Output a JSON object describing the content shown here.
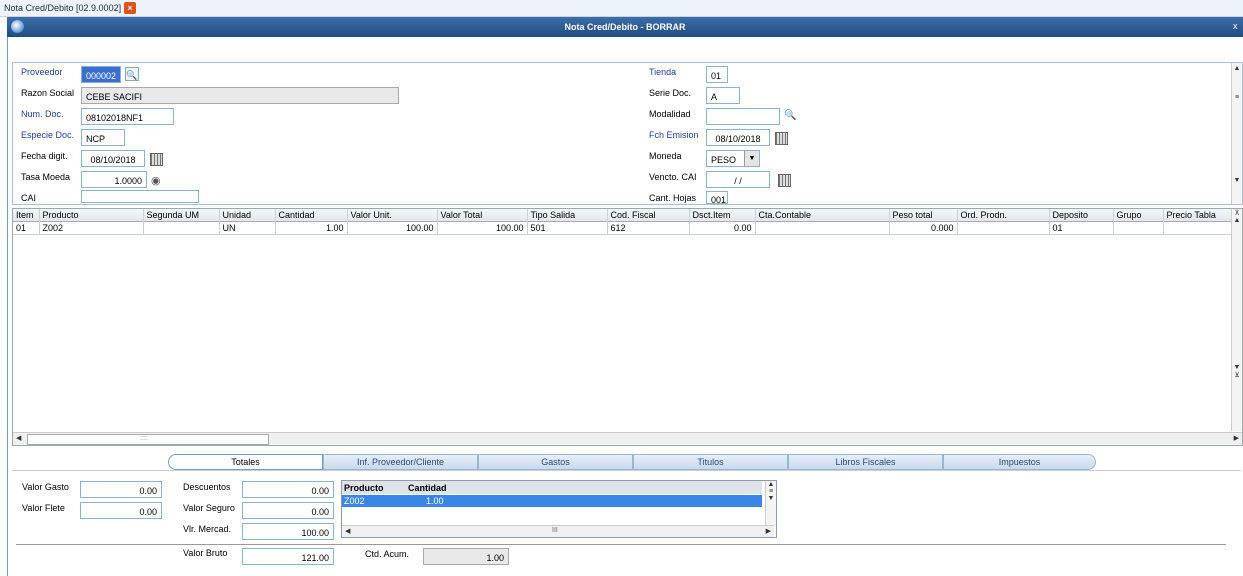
{
  "tab": {
    "label": "Nota Cred/Debito [02.9.0002]",
    "close": "×"
  },
  "window": {
    "title": "Nota Cred/Debito - BORRAR",
    "close": "x"
  },
  "header": {
    "proveedor": {
      "label": "Proveedor",
      "value": "000002"
    },
    "razon_social": {
      "label": "Razon Social",
      "value": "CEBE SACIFI"
    },
    "num_doc": {
      "label": "Num. Doc.",
      "value": "08102018NF1"
    },
    "especie_doc": {
      "label": "Especie Doc.",
      "value": "NCP"
    },
    "fecha_digit": {
      "label": "Fecha digit.",
      "value": "08/10/2018"
    },
    "tasa_moeda": {
      "label": "Tasa Moeda",
      "value": "1.0000"
    },
    "cai": {
      "label": "CAI",
      "value": ""
    },
    "tienda": {
      "label": "Tienda",
      "value": "01"
    },
    "serie_doc": {
      "label": "Serie Doc.",
      "value": "A"
    },
    "modalidad": {
      "label": "Modalidad",
      "value": ""
    },
    "fch_emision": {
      "label": "Fch Emision",
      "value": "08/10/2018"
    },
    "moneda": {
      "label": "Moneda",
      "value": "PESO"
    },
    "vencto_cai": {
      "label": "Vencto. CAI",
      "value": "/ /"
    },
    "cant_hojas": {
      "label": "Cant. Hojas",
      "value": "001"
    }
  },
  "grid": {
    "columns": [
      "Item",
      "Producto",
      "Segunda UM",
      "Unidad",
      "Cantidad",
      "Valor Unit.",
      "Valor Total",
      "Tipo Salida",
      "Cod. Fiscal",
      "Dsct.Item",
      "Cta.Contable",
      "Peso total",
      "Ord. Prodn.",
      "Deposito",
      "Grupo",
      "Precio Tabla"
    ],
    "rows": [
      [
        "01",
        "Z002",
        "",
        "UN",
        "1.00",
        "100.00",
        "100.00",
        "501",
        "612",
        "0.00",
        "",
        "0.000",
        "",
        "01",
        "",
        ""
      ]
    ],
    "hscroll_mark": "::::"
  },
  "bottom_tabs": [
    "Totales",
    "Inf. Proveedor/Cliente",
    "Gastos",
    "Titulos",
    "Libros Fiscales",
    "Impuestos"
  ],
  "totals": {
    "valor_gasto": {
      "label": "Valor Gasto",
      "value": "0.00"
    },
    "valor_flete": {
      "label": "Valor Flete",
      "value": "0.00"
    },
    "descuentos": {
      "label": "Descuentos",
      "value": "0.00"
    },
    "valor_seguro": {
      "label": "Valor Seguro",
      "value": "0.00"
    },
    "vlr_mercad": {
      "label": "Vlr. Mercad.",
      "value": "100.00"
    },
    "valor_bruto": {
      "label": "Valor Bruto",
      "value": "121.00"
    },
    "ctd_acum": {
      "label": "Ctd. Acum.",
      "value": "1.00"
    }
  },
  "mini_grid": {
    "columns": [
      "Producto",
      "Cantidad"
    ],
    "rows": [
      [
        "Z002",
        "1.00"
      ]
    ],
    "hscroll_mark": "III"
  },
  "colors": {
    "title_bar": "#1e4b82",
    "selection": "#3a6fd2",
    "required_label": "#1e3fa0"
  }
}
